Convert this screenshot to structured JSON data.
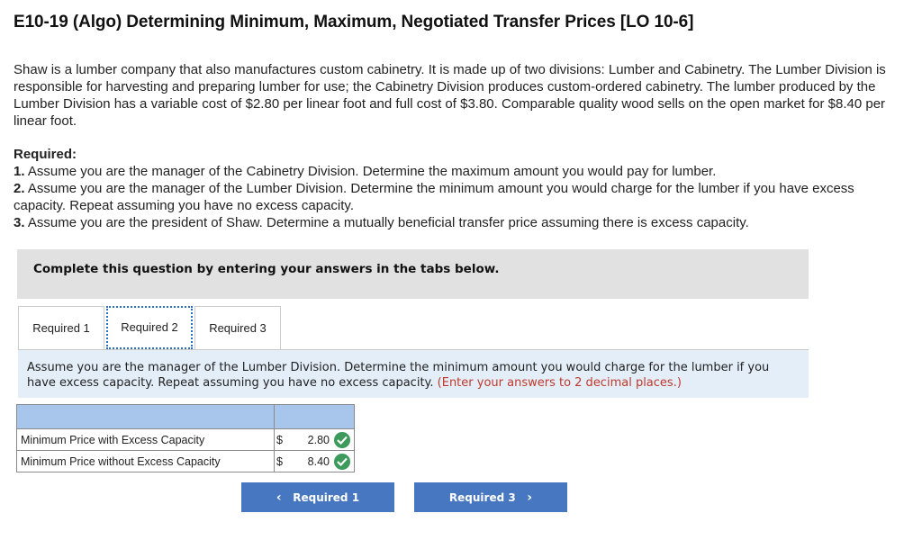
{
  "page": {
    "title": "E10-19 (Algo) Determining Minimum, Maximum, Negotiated Transfer Prices [LO 10-6]"
  },
  "intro": "Shaw is a lumber company that also manufactures custom cabinetry. It is made up of two divisions: Lumber and Cabinetry. The Lumber Division is responsible for harvesting and preparing lumber for use; the Cabinetry Division produces custom-ordered cabinetry. The lumber produced by the Lumber Division has a variable cost of $2.80 per linear foot and full cost of $3.80. Comparable quality wood sells on the open market for $8.40 per linear foot.",
  "required": {
    "heading": "Required:",
    "items": [
      {
        "num": "1.",
        "text": "Assume you are the manager of the Cabinetry Division. Determine the maximum amount you would pay for lumber."
      },
      {
        "num": "2.",
        "text": "Assume you are the manager of the Lumber Division. Determine the minimum amount you would charge for the lumber if you have excess capacity. Repeat assuming you have no excess capacity."
      },
      {
        "num": "3.",
        "text": "Assume you are the president of Shaw. Determine a mutually beneficial transfer price assuming there is excess capacity."
      }
    ]
  },
  "banner": "Complete this question by entering your answers in the tabs below.",
  "tabs": [
    {
      "label": "Required 1"
    },
    {
      "label": "Required 2"
    },
    {
      "label": "Required 3"
    }
  ],
  "instruction": {
    "text": "Assume you are the manager of the Lumber Division. Determine the minimum amount you would charge for the lumber if you have excess capacity. Repeat assuming you have no excess capacity.",
    "hint": "(Enter your answers to 2 decimal places.)"
  },
  "table": {
    "rows": [
      {
        "label": "Minimum Price with Excess Capacity",
        "currency": "$",
        "value": "2.80"
      },
      {
        "label": "Minimum Price without Excess Capacity",
        "currency": "$",
        "value": "8.40"
      }
    ]
  },
  "nav": {
    "prev_label": "Required 1",
    "next_label": "Required 3",
    "prev_icon": "chevron-left-icon",
    "next_icon": "chevron-right-icon"
  },
  "colors": {
    "tab_header": "#a8c6eb",
    "instruction_bg": "#e3eef9",
    "hint": "#c0392b",
    "button": "#4677c0",
    "check": "#3c9a5b"
  }
}
